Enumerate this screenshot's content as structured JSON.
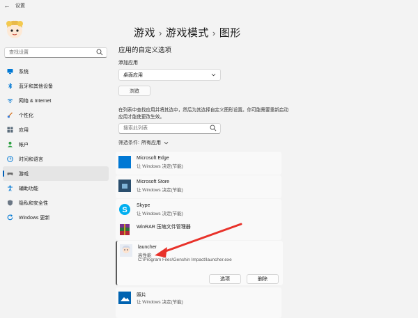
{
  "window": {
    "title": "设置"
  },
  "sidebar": {
    "search_placeholder": "查找设置",
    "items": [
      {
        "label": "系统",
        "icon": "monitor-icon"
      },
      {
        "label": "蓝牙和其他设备",
        "icon": "bluetooth-icon"
      },
      {
        "label": "网络 & Internet",
        "icon": "wifi-icon"
      },
      {
        "label": "个性化",
        "icon": "brush-icon"
      },
      {
        "label": "应用",
        "icon": "apps-icon"
      },
      {
        "label": "帐户",
        "icon": "person-icon"
      },
      {
        "label": "时间和语言",
        "icon": "globe-clock-icon"
      },
      {
        "label": "游戏",
        "icon": "gamepad-icon",
        "active": true
      },
      {
        "label": "辅助功能",
        "icon": "accessibility-icon"
      },
      {
        "label": "隐私和安全性",
        "icon": "shield-icon"
      },
      {
        "label": "Windows 更新",
        "icon": "update-icon"
      }
    ]
  },
  "breadcrumb": [
    "游戏",
    "游戏模式",
    "图形"
  ],
  "main": {
    "section_title": "应用的自定义选项",
    "add_app_label": "添加应用",
    "dropdown_value": "桌面应用",
    "browse_label": "浏览",
    "description": "在列表中查找应用并将其选中，然后为其选择自定义图形设置。你可能需要重新启动应用才能使更改生效。",
    "list_search_placeholder": "搜索此列表",
    "filter_label": "筛选条件:",
    "filter_value": "所有应用"
  },
  "apps": [
    {
      "name": "Microsoft Edge",
      "status": "让 Windows 决定(节能)",
      "icon": "edge-tile-icon"
    },
    {
      "name": "Microsoft Store",
      "status": "让 Windows 决定(节能)",
      "icon": "store-tile-icon"
    },
    {
      "name": "Skype",
      "status": "让 Windows 决定(节能)",
      "icon": "skype-tile-icon"
    },
    {
      "name": "WinRAR 压缩文件管理器",
      "status": "",
      "icon": "winrar-tile-icon"
    },
    {
      "name": "launcher",
      "status": "高性能",
      "path": "C:\\Program Files\\Genshin Impact\\launcher.exe",
      "icon": "launcher-tile-icon",
      "options_label": "选项",
      "delete_label": "删除"
    },
    {
      "name": "照片",
      "status": "让 Windows 决定(节能)",
      "icon": "photos-tile-icon"
    }
  ],
  "colors": {
    "accent": "#005fb8",
    "annotation_arrow": "#e8322a",
    "tile_blue": "#0078d4"
  }
}
